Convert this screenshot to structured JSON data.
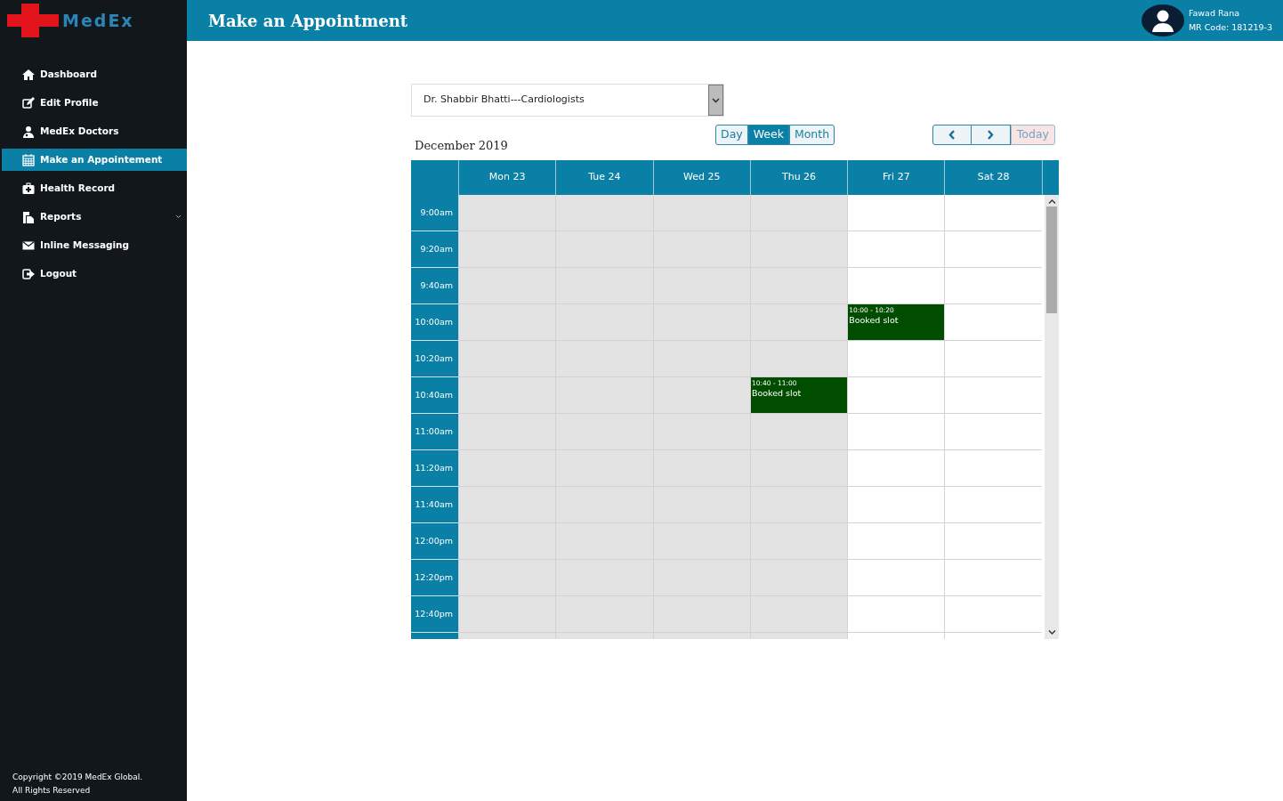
{
  "logo": {
    "text": "MedEx"
  },
  "header": {
    "title": "Make an Appointment",
    "user_name": "Fawad Rana",
    "mr_code": "MR Code: 181219-3"
  },
  "sidebar": {
    "items": [
      {
        "label": "Dashboard",
        "selected": false,
        "expandable": false
      },
      {
        "label": "Edit Profile",
        "selected": false,
        "expandable": false
      },
      {
        "label": "MedEx Doctors",
        "selected": false,
        "expandable": false
      },
      {
        "label": "Make an Appointement",
        "selected": true,
        "expandable": false
      },
      {
        "label": "Health Record",
        "selected": false,
        "expandable": false
      },
      {
        "label": "Reports",
        "selected": false,
        "expandable": true
      },
      {
        "label": "Inline Messaging",
        "selected": false,
        "expandable": false
      },
      {
        "label": "Logout",
        "selected": false,
        "expandable": false
      }
    ],
    "copyright": [
      "Copyright ©2019 MedEx Global.",
      "All Rights Reserved"
    ]
  },
  "doctor_select": {
    "value": "Dr. Shabbir Bhatti---Cardiologists"
  },
  "calendar": {
    "title": "December 2019",
    "views": [
      {
        "label": "Day",
        "selected": false
      },
      {
        "label": "Week",
        "selected": true
      },
      {
        "label": "Month",
        "selected": false
      }
    ],
    "today_button": {
      "label": "Today",
      "disabled": true
    },
    "days": [
      {
        "label": "Mon 23",
        "past": true
      },
      {
        "label": "Tue 24",
        "past": true
      },
      {
        "label": "Wed 25",
        "past": true
      },
      {
        "label": "Thu 26",
        "past": true
      },
      {
        "label": "Fri 27",
        "past": false
      },
      {
        "label": "Sat 28",
        "past": false
      }
    ],
    "times": [
      "9:00am",
      "9:20am",
      "9:40am",
      "10:00am",
      "10:20am",
      "10:40am",
      "11:00am",
      "11:20am",
      "11:40am",
      "12:00pm",
      "12:20pm",
      "12:40pm"
    ],
    "events": [
      {
        "time": "10:00 - 10:20",
        "title": "Booked slot"
      },
      {
        "time": "10:40 - 11:00",
        "title": "Booked slot"
      }
    ]
  }
}
